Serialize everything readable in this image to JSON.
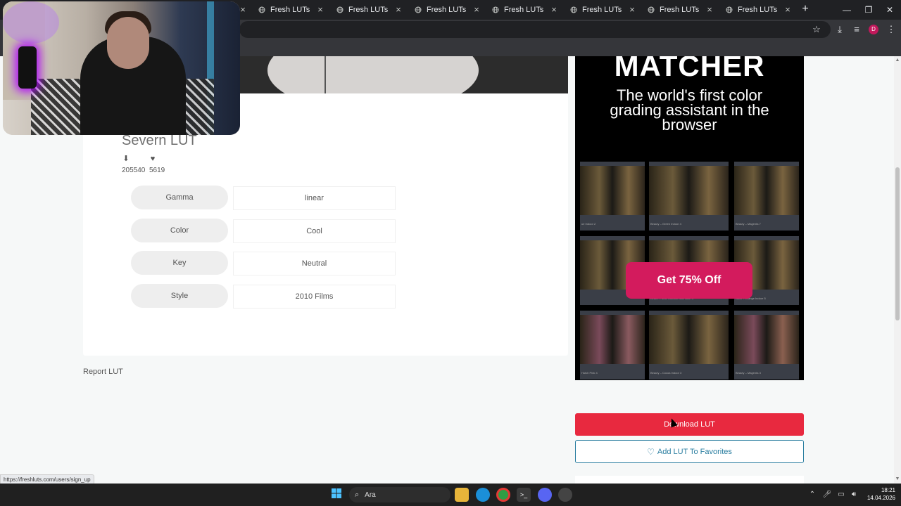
{
  "browser": {
    "tabs": [
      {
        "title": "Fresh LUTs"
      },
      {
        "title": "Fresh LUTs"
      },
      {
        "title": "Fresh LUTs"
      },
      {
        "title": "Fresh LUTs"
      },
      {
        "title": "Fresh LUTs"
      },
      {
        "title": "Fresh LUTs"
      },
      {
        "title": "Fresh LUTs"
      }
    ],
    "new_tab_glyph": "+",
    "profile_initial": "D",
    "status_url": "https://freshluts.com/users/sign_up"
  },
  "lut": {
    "title": "Severn LUT",
    "downloads": "205540",
    "favorites": "5619",
    "attributes": [
      {
        "label": "Gamma",
        "value": "linear"
      },
      {
        "label": "Color",
        "value": "Cool"
      },
      {
        "label": "Key",
        "value": "Neutral"
      },
      {
        "label": "Style",
        "value": "2010 Films"
      }
    ],
    "report_label": "Report LUT"
  },
  "ad": {
    "brand": "MATCHER",
    "tagline": "The world's first color grading assistant in the browser",
    "cta": "Get 75% Off",
    "thumbnails": [
      {
        "caption": "ue Indoor 2"
      },
      {
        "caption": "Beauty – Green Indoor 4"
      },
      {
        "caption": "Beauty – Magenta 7"
      },
      {
        "caption": ""
      },
      {
        "caption": "Beach – Blue Outdoor Afternoon 4"
      },
      {
        "caption": "Bank – Orange Indoor 5"
      },
      {
        "caption": "Hutch Pink 4"
      },
      {
        "caption": "Beauty – Cocoa Indoor 3"
      },
      {
        "caption": "Beauty – Magenta 3"
      }
    ]
  },
  "actions": {
    "download_label": "Download LUT",
    "favorite_label": "Add LUT To Favorites"
  },
  "taskbar": {
    "search_placeholder": "Ara",
    "time": "18:21",
    "date": "14.04.2026"
  },
  "colors": {
    "download_button": "#e8293f",
    "favorite_border": "#2a7ea0",
    "cta": "#d31b5d"
  }
}
